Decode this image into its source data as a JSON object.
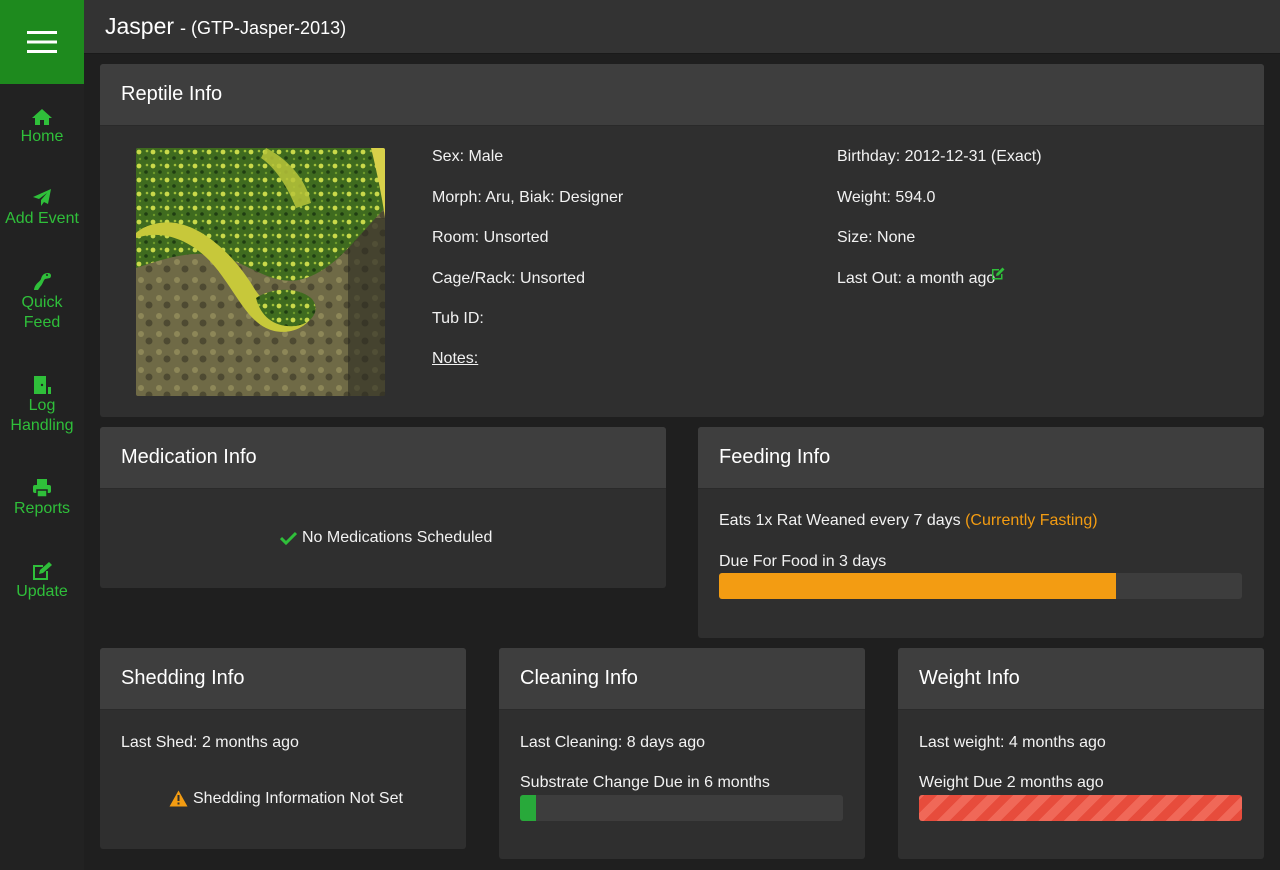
{
  "header": {
    "name": "Jasper",
    "subtitle": "- (GTP-Jasper-2013)"
  },
  "sidebar": {
    "items": [
      {
        "label": "Home",
        "icon": "home-icon"
      },
      {
        "label": "Add Event",
        "icon": "paper-plane-icon"
      },
      {
        "label": "Quick Feed",
        "label_lines": [
          "Quick",
          "Feed"
        ],
        "icon": "snake-head-icon"
      },
      {
        "label": "Log Handling",
        "label_lines": [
          "Log",
          "Handling"
        ],
        "icon": "door-icon"
      },
      {
        "label": "Reports",
        "icon": "printer-icon"
      },
      {
        "label": "Update",
        "icon": "edit-icon"
      }
    ]
  },
  "reptile_info": {
    "title": "Reptile Info",
    "photo": "green tree python photo",
    "sex": "Sex: Male",
    "morph": "Morph: Aru, Biak: Designer",
    "room": "Room: Unsorted",
    "cage": "Cage/Rack: Unsorted",
    "tub": "Tub ID:",
    "notes": "Notes:",
    "birthday": "Birthday: 2012-12-31 (Exact)",
    "weight": "Weight: 594.0",
    "size": "Size: None",
    "last_out": "Last Out: a month ago"
  },
  "medication_info": {
    "title": "Medication Info",
    "status": "No Medications Scheduled"
  },
  "feeding_info": {
    "title": "Feeding Info",
    "schedule": "Eats 1x Rat Weaned every 7 days",
    "fasting": "(Currently Fasting)",
    "due": "Due For Food in 3 days",
    "progress": 0.76
  },
  "shedding_info": {
    "title": "Shedding Info",
    "last": "Last Shed: 2 months ago",
    "warning": "Shedding Information Not Set"
  },
  "cleaning_info": {
    "title": "Cleaning Info",
    "last": "Last Cleaning: 8 days ago",
    "due": "Substrate Change Due in 6 months",
    "progress": 0.05
  },
  "weight_info": {
    "title": "Weight Info",
    "last": "Last weight: 4 months ago",
    "due": "Weight Due 2 months ago",
    "progress": 1.0
  },
  "colors": {
    "accent_green": "#2fbf3a",
    "sidebar_top": "#1e8a1e",
    "warning_orange": "#f39c12",
    "danger_red": "#e74c3c"
  }
}
